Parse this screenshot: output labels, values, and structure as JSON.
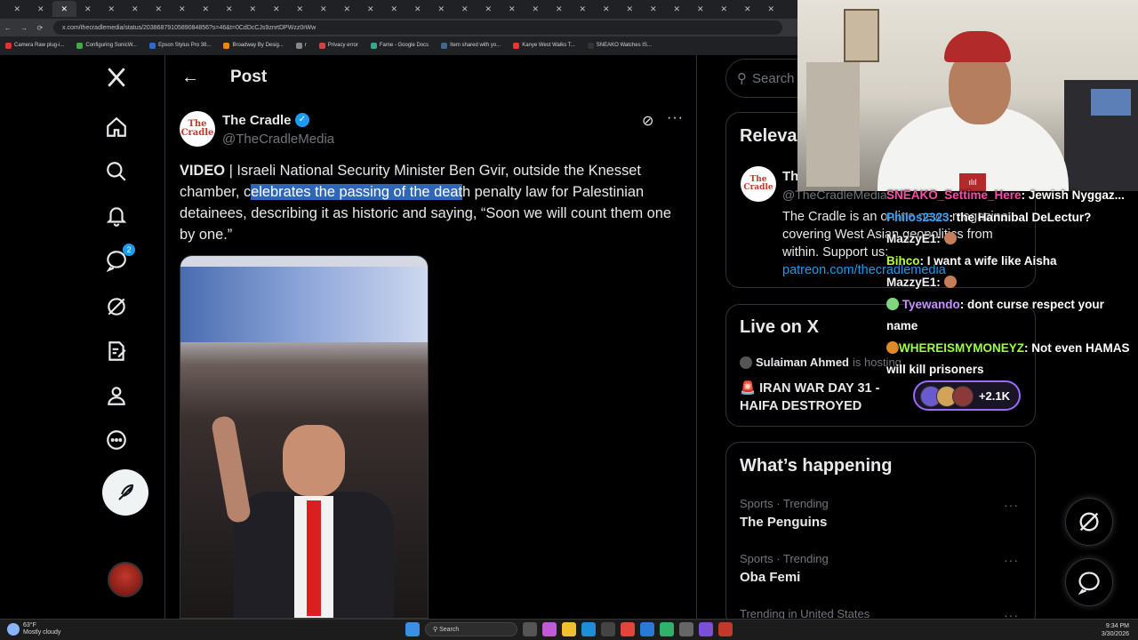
{
  "browser": {
    "address": "x.com/thecradlemedia/status/2038687910589084856?s=46&t=0CdDcCJs9znrtDPWzz0rWw",
    "bookmarks": [
      "Camera Raw plug-i...",
      "Configuring SonicW...",
      "Epson Stylus Pro 38...",
      "Broadway By Desig...",
      "r",
      "Privacy error",
      "Fame - Google Docs",
      "Item shared with yo...",
      "Kanye West Walks T...",
      "SNEAKO Watches IS..."
    ]
  },
  "header": {
    "back_icon": "←",
    "title": "Post"
  },
  "nav": {
    "notifications_badge": "2"
  },
  "post": {
    "author_name": "The Cradle",
    "author_handle": "@TheCradleMedia",
    "avatar_text": "The Cradle",
    "text_bold": "VIDEO",
    "text_1": " | Israeli National Security Minister Ben Gvir, outside the Knesset chamber, c",
    "text_highlight": "elebrates the passing of the deat",
    "text_2": "h penalty law for Palestinian detainees, describing it as historic and saying, “Soon we will count them one by one.”"
  },
  "sidebar": {
    "search_placeholder": "Search",
    "relevant": {
      "title": "Relevant people",
      "name": "The Cradle",
      "handle": "@TheCradleMedia",
      "bio": "The Cradle is an online news magazine covering West Asian geopolitics from within. Support us:",
      "link": "patreon.com/thecradlemedia"
    },
    "live": {
      "title": "Live on X",
      "host": "Sulaiman Ahmed",
      "host_suffix": "is hosting",
      "space_title": "🚨 IRAN WAR DAY 31 - HAIFA DESTROYED"
    },
    "happening": {
      "title": "What’s happening",
      "trends": [
        {
          "context": "Sports · Trending",
          "name": "The Penguins"
        },
        {
          "context": "Sports · Trending",
          "name": "Oba Femi"
        },
        {
          "context": "Trending in United States",
          "name": ""
        }
      ]
    }
  },
  "chat": [
    {
      "user": "SNEAKO_Settime_Here",
      "msg": "Jewish Nyggaz..."
    },
    {
      "user": "Philos2323",
      "msg": "the Hannibal DeLectur?"
    },
    {
      "user": "MazzyE1",
      "msg": ""
    },
    {
      "user": "Bihco",
      "msg": "I want a wife like Aisha"
    },
    {
      "user": "MazzyE1",
      "msg": ""
    },
    {
      "user": "Tyewando",
      "msg": "dont curse respect your name"
    },
    {
      "user": "WHEREISMYMONEYZ",
      "msg": "Not even HAMAS will kill prisoners"
    }
  ],
  "viewers": "+2.1K",
  "taskbar": {
    "temp": "63°F",
    "weather": "Mostly cloudy",
    "search": "Search",
    "time": "9:34 PM",
    "date": "3/30/2026"
  }
}
